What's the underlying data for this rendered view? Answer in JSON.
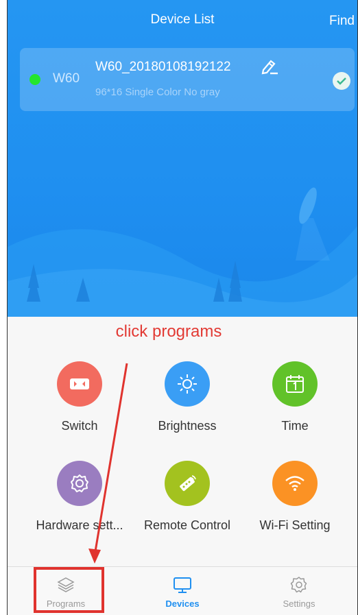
{
  "header": {
    "title": "Device List",
    "find_label": "Find"
  },
  "device": {
    "status_color": "#24e52d",
    "short_name": "W60",
    "name": "W60_20180108192122",
    "spec": "96*16  Single Color  No gray",
    "selected": true
  },
  "annotation": {
    "text": "click programs",
    "color": "#e23a34"
  },
  "functions": [
    {
      "label": "Switch",
      "icon": "switch-icon",
      "color": "#f26b5f"
    },
    {
      "label": "Brightness",
      "icon": "brightness-icon",
      "color": "#3a9ef5"
    },
    {
      "label": "Time",
      "icon": "calendar-icon",
      "color": "#61c229"
    },
    {
      "label": "Hardware sett...",
      "icon": "gear-icon",
      "color": "#9a7dc0"
    },
    {
      "label": "Remote Control",
      "icon": "remote-icon",
      "color": "#a3c21f"
    },
    {
      "label": "Wi-Fi Setting",
      "icon": "wifi-icon",
      "color": "#fb9224"
    }
  ],
  "tabs": [
    {
      "label": "Programs",
      "icon": "layers-icon",
      "active": false
    },
    {
      "label": "Devices",
      "icon": "monitor-icon",
      "active": true
    },
    {
      "label": "Settings",
      "icon": "gear-icon",
      "active": false
    }
  ],
  "colors": {
    "accent": "#1f8ff0",
    "inactive": "#999999"
  }
}
